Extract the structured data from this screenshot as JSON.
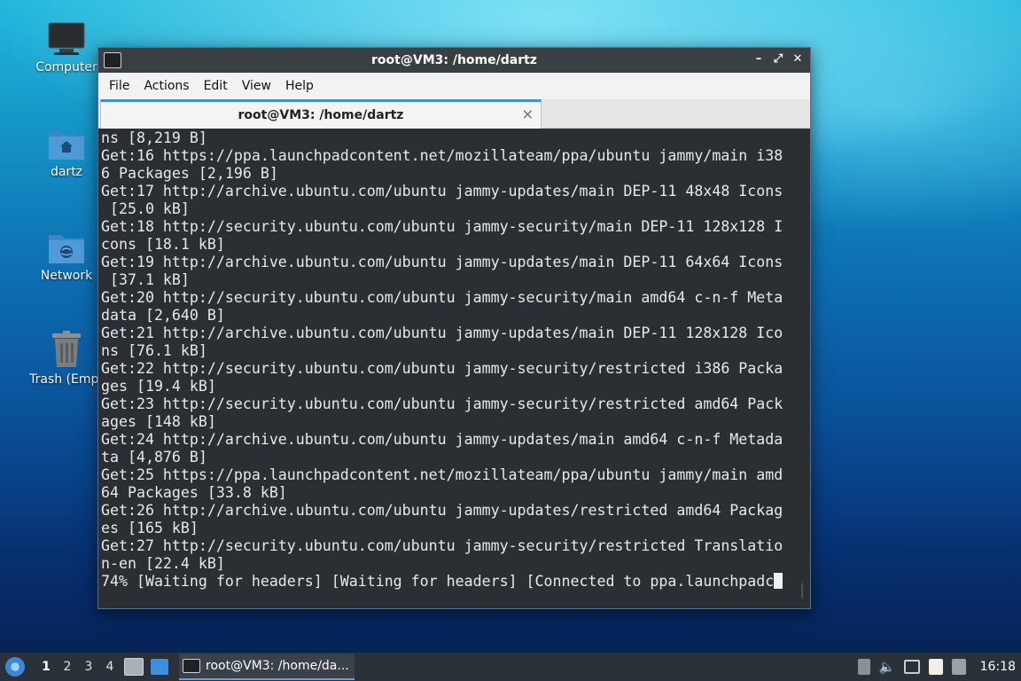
{
  "desktop": {
    "icons": [
      {
        "label": "Computer",
        "icon": "monitor-icon"
      },
      {
        "label": "dartz",
        "icon": "home-folder-icon"
      },
      {
        "label": "Network",
        "icon": "network-folder-icon"
      },
      {
        "label": "Trash (Empt",
        "icon": "trash-icon"
      }
    ]
  },
  "window": {
    "title": "root@VM3: /home/dartz",
    "menu": [
      "File",
      "Actions",
      "Edit",
      "View",
      "Help"
    ],
    "tab_label": "root@VM3: /home/dartz",
    "tab_close": "×",
    "controls": {
      "minimize": "–",
      "maximize": "⤢",
      "close": "✕"
    }
  },
  "terminal": {
    "lines": [
      "ns [8,219 B]",
      "Get:16 https://ppa.launchpadcontent.net/mozillateam/ppa/ubuntu jammy/main i38",
      "6 Packages [2,196 B]",
      "Get:17 http://archive.ubuntu.com/ubuntu jammy-updates/main DEP-11 48x48 Icons",
      " [25.0 kB]",
      "Get:18 http://security.ubuntu.com/ubuntu jammy-security/main DEP-11 128x128 I",
      "cons [18.1 kB]",
      "Get:19 http://archive.ubuntu.com/ubuntu jammy-updates/main DEP-11 64x64 Icons",
      " [37.1 kB]",
      "Get:20 http://security.ubuntu.com/ubuntu jammy-security/main amd64 c-n-f Meta",
      "data [2,640 B]",
      "Get:21 http://archive.ubuntu.com/ubuntu jammy-updates/main DEP-11 128x128 Ico",
      "ns [76.1 kB]",
      "Get:22 http://security.ubuntu.com/ubuntu jammy-security/restricted i386 Packa",
      "ges [19.4 kB]",
      "Get:23 http://security.ubuntu.com/ubuntu jammy-security/restricted amd64 Pack",
      "ages [148 kB]",
      "Get:24 http://archive.ubuntu.com/ubuntu jammy-updates/main amd64 c-n-f Metada",
      "ta [4,876 B]",
      "Get:25 https://ppa.launchpadcontent.net/mozillateam/ppa/ubuntu jammy/main amd",
      "64 Packages [33.8 kB]",
      "Get:26 http://archive.ubuntu.com/ubuntu jammy-updates/restricted amd64 Packag",
      "es [165 kB]",
      "Get:27 http://security.ubuntu.com/ubuntu jammy-security/restricted Translatio",
      "n-en [22.4 kB]"
    ],
    "prompt_line": "74% [Waiting for headers] [Waiting for headers] [Connected to ppa.launchpadc"
  },
  "taskbar": {
    "workspaces": [
      "1",
      "2",
      "3",
      "4"
    ],
    "active_workspace": "1",
    "task_label": "root@VM3: /home/da...",
    "clock": "16:18"
  }
}
